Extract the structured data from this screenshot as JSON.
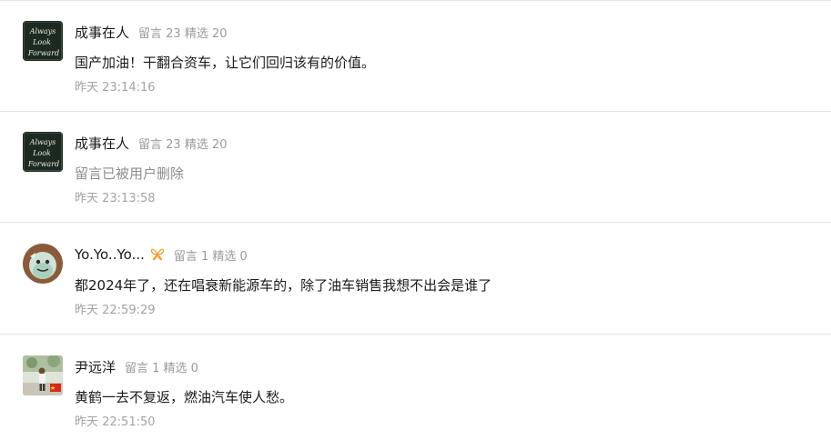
{
  "comments": [
    {
      "nickname": "成事在人",
      "stats": "留言 23 精选 20",
      "content": "国产加油！干翻合资车，让它们回归该有的价值。",
      "time": "昨天 23:14:16",
      "avatar_icon": "chalkboard-avatar"
    },
    {
      "nickname": "成事在人",
      "stats": "留言 23 精选 20",
      "content": "留言已被用户删除",
      "time": "昨天 23:13:58",
      "avatar_icon": "chalkboard-avatar"
    },
    {
      "nickname": "Yo.Yo..Yo...",
      "stats": "留言 1 精选 0",
      "content": "都2024年了，还在唱衰新能源车的，除了油车销售我想不出会是谁了",
      "time": "昨天 22:59:29",
      "avatar_icon": "cartoon-avatar",
      "badge_icon": "butterfly-icon"
    },
    {
      "nickname": "尹远洋",
      "stats": "留言 1 精选 0",
      "content": "黄鹤一去不复返，燃油汽车使人愁。",
      "time": "昨天 22:51:50",
      "avatar_icon": "photo-avatar"
    }
  ],
  "colors": {
    "badge": "#f0a030",
    "meta": "#9b9b9b",
    "divider": "#e3e3e3"
  }
}
